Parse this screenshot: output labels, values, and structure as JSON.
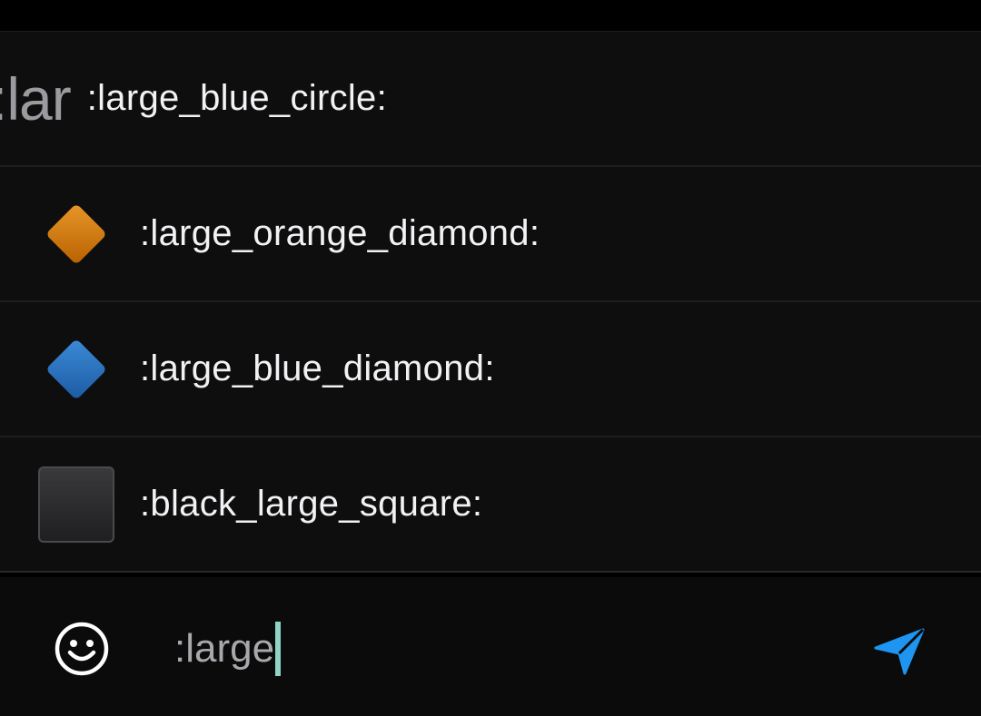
{
  "suggestions": [
    {
      "prefix": ":lar",
      "label": ":large_blue_circle:",
      "icon": "text-prefix"
    },
    {
      "label": ":large_orange_diamond:",
      "icon": "orange-diamond-icon",
      "color": "#d07a0c"
    },
    {
      "label": ":large_blue_diamond:",
      "icon": "blue-diamond-icon",
      "color": "#2a6fbd"
    },
    {
      "label": ":black_large_square:",
      "icon": "black-square-icon",
      "color": "#2a2a2c"
    }
  ],
  "composer": {
    "input_value": ":large",
    "emoji_icon": "smiley-icon",
    "send_icon": "send-icon"
  },
  "colors": {
    "accent": "#1e95f0",
    "caret": "#8fd4c4",
    "background": "#0e0e0f"
  }
}
